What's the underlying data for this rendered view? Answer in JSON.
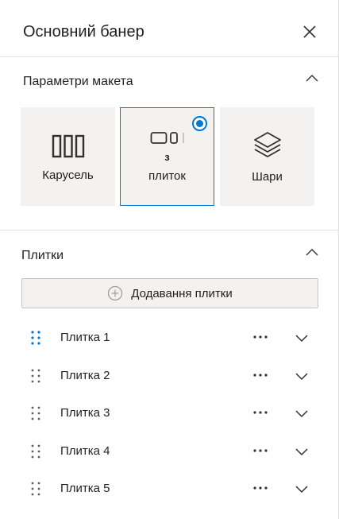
{
  "panel": {
    "title": "Основний банер",
    "close_icon": "close-icon"
  },
  "layout_section": {
    "title": "Параметри макета",
    "options": [
      {
        "label": "Карусель",
        "icon": "carousel-icon",
        "selected": false
      },
      {
        "label_line1": "з",
        "label_line2": "плиток",
        "icon": "tiles-icon",
        "selected": true
      },
      {
        "label": "Шари",
        "icon": "layers-icon",
        "selected": false
      }
    ]
  },
  "tiles_section": {
    "title": "Плитки",
    "add_label": "Додавання плитки",
    "tiles": [
      {
        "label": "Плитка 1",
        "active": true
      },
      {
        "label": "Плитка 2",
        "active": false
      },
      {
        "label": "Плитка 3",
        "active": false
      },
      {
        "label": "Плитка 4",
        "active": false
      },
      {
        "label": "Плитка 5",
        "active": false
      }
    ]
  },
  "colors": {
    "accent": "#0078d4",
    "option_bg": "#f3f2f1",
    "divider": "#e1dfdd"
  }
}
